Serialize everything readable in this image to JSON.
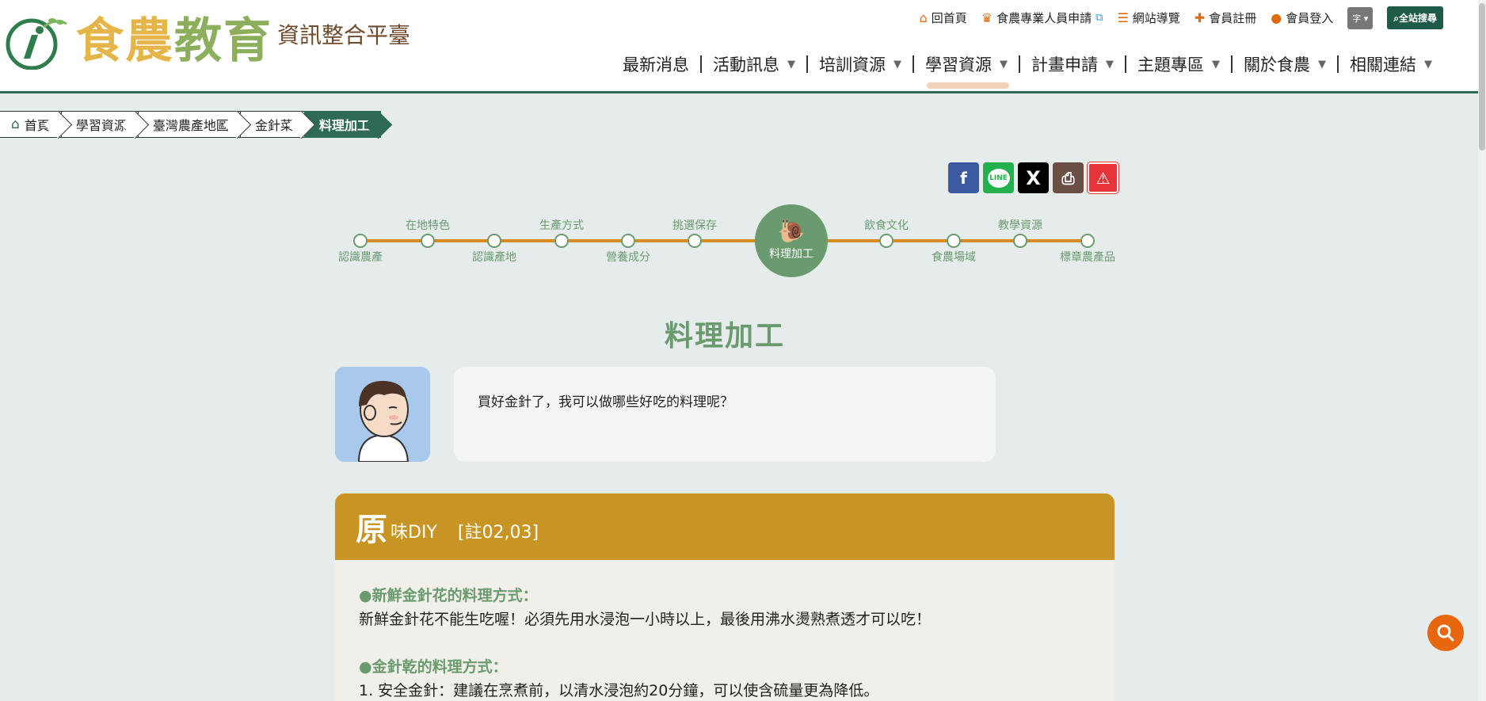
{
  "header": {
    "logo_chars": [
      "食",
      "農",
      "教",
      "育"
    ],
    "logo_subtitle": "資訊整合平臺",
    "top_links": [
      {
        "label": "回首頁",
        "icon": "home-icon"
      },
      {
        "label": "食農專業人員申請",
        "icon": "certificate-icon"
      },
      {
        "label": "網站導覽",
        "icon": "signpost-icon"
      },
      {
        "label": "會員註冊",
        "icon": "user-plus-icon"
      },
      {
        "label": "會員登入",
        "icon": "user-circle-icon"
      }
    ],
    "font_button": "字",
    "site_search": "全站搜尋",
    "nav": [
      {
        "label": "最新消息"
      },
      {
        "label": "活動訊息"
      },
      {
        "label": "培訓資源"
      },
      {
        "label": "學習資源"
      },
      {
        "label": "計畫申請"
      },
      {
        "label": "主題專區"
      },
      {
        "label": "關於食農"
      },
      {
        "label": "相關連結"
      }
    ]
  },
  "breadcrumb": [
    "首頁",
    "學習資源",
    "臺灣農產地圖",
    "金針菜",
    "料理加工"
  ],
  "share": {
    "x_label": "X",
    "line_label": "LINE"
  },
  "timeline": {
    "top_labels": [
      "在地特色",
      "生產方式",
      "挑選保存",
      "飲食文化",
      "教學資源"
    ],
    "bottom_labels": [
      "認識農產",
      "認識產地",
      "營養成分",
      "食農場域",
      "標章農產品"
    ],
    "current": "料理加工"
  },
  "page_title": "料理加工",
  "dialog": {
    "text": "買好金針了，我可以做哪些好吃的料理呢？"
  },
  "card": {
    "big_char": "原",
    "head_rest": "味DIY",
    "note": "[註02,03]",
    "sections": [
      {
        "heading": "●新鮮金針花的料理方式：",
        "text": "新鮮金針花不能生吃喔！必須先用水浸泡一小時以上，最後用沸水燙熟煮透才可以吃！"
      },
      {
        "heading": "●金針乾的料理方式：",
        "text": "1. 安全金針：建議在烹煮前，以清水浸泡約20分鐘，可以使含硫量更為降低。"
      }
    ]
  },
  "colors": {
    "brand_green": "#2e6a55",
    "timeline_orange": "#d68b1f",
    "card_gold": "#c89524",
    "label_green": "#6a9b6f",
    "fab_orange": "#e8670e"
  }
}
